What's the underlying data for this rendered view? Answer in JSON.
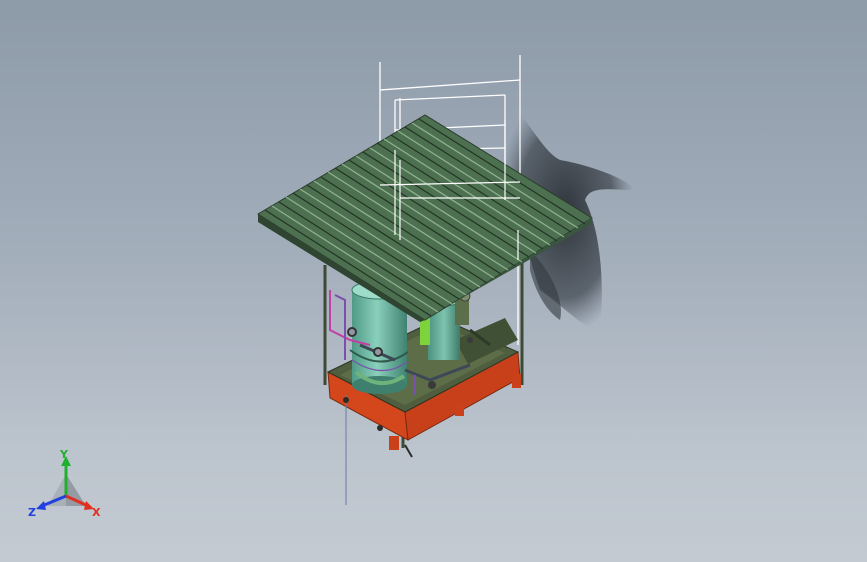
{
  "viewport": {
    "background_top": "#8d9aa8",
    "background_bottom": "#c3cad2"
  },
  "model": {
    "roof_color": "#4d7050",
    "tank_color": "#62b09a",
    "skid_color": "#d4461c",
    "frame_color": "#4a5a3e",
    "green_component_color": "#7ed23c"
  },
  "triad": {
    "x_label": "X",
    "y_label": "Y",
    "z_label": "Z",
    "x_color": "#e03020",
    "y_color": "#20b030",
    "z_color": "#2040e0"
  }
}
